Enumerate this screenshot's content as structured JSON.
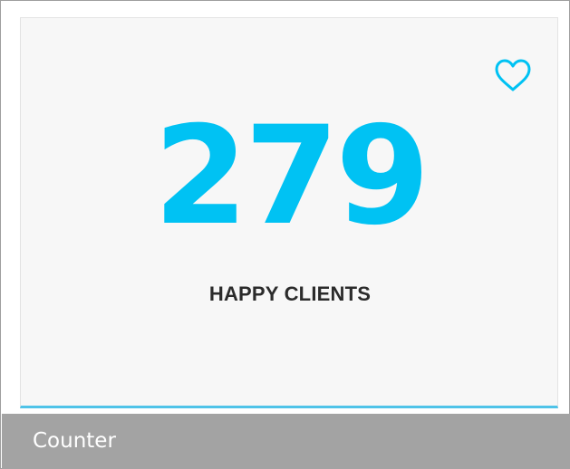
{
  "counter": {
    "value": "279",
    "label": "HAPPY CLIENTS",
    "icon": "heart-outline-icon",
    "accent_color": "#00c2f3",
    "underline_color": "#4fc3e8"
  },
  "caption": {
    "text": "Counter",
    "background_color": "#a3a3a3"
  }
}
